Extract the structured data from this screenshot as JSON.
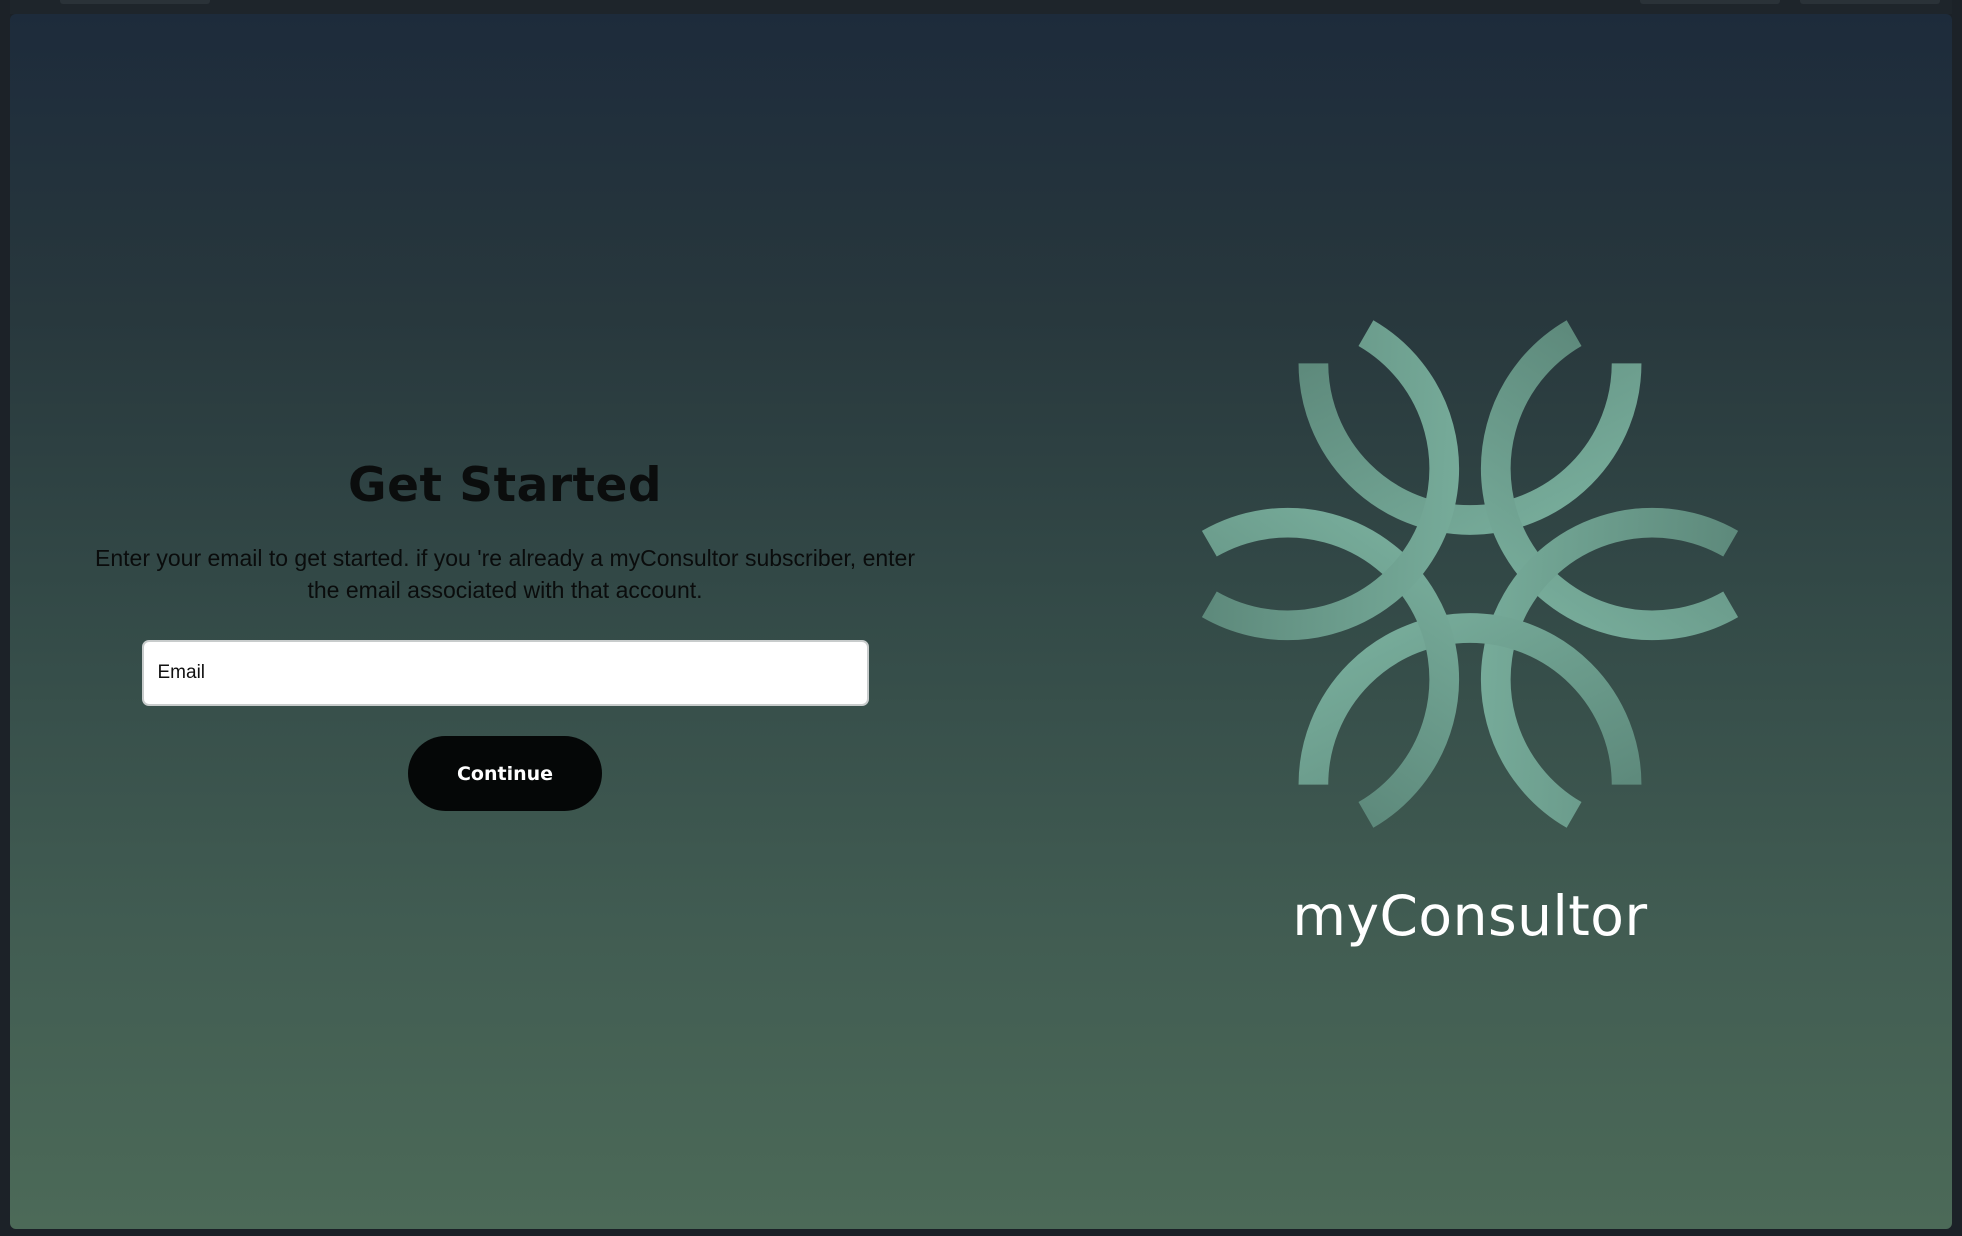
{
  "page": {
    "title": "Get Started",
    "description": "Enter your email to get started. if you 're already a myConsultor subscriber, enter the email associated with that account."
  },
  "form": {
    "email_placeholder": "Email",
    "email_value": "",
    "continue_label": "Continue"
  },
  "brand": {
    "name": "myConsultor",
    "logo_icon": "myconsultor-logo-icon"
  },
  "colors": {
    "gradient_top": "#1d2b3b",
    "gradient_bottom": "#4c6a58",
    "logo_arc": "#74a898",
    "logo_arc_shade": "#5e8a7c",
    "button_background": "#050707",
    "button_text": "#ffffff"
  }
}
